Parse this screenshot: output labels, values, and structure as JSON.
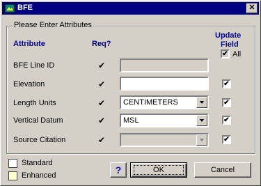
{
  "window": {
    "title": "BFE"
  },
  "group": {
    "caption": "Please Enter Attributes"
  },
  "headers": {
    "attribute": "Attribute",
    "req": "Req?",
    "update": "Update\nField",
    "update_line1": "Update",
    "update_line2": "Field",
    "all": "All"
  },
  "rows": [
    {
      "label": "BFE Line ID",
      "req": "✔",
      "value": "",
      "type": "text",
      "enabled": false,
      "update": false
    },
    {
      "label": "Elevation",
      "req": "✔",
      "value": "",
      "type": "text",
      "enabled": true,
      "update": true
    },
    {
      "label": "Length Units",
      "req": "✔",
      "value": "CENTIMETERS",
      "type": "combo",
      "enabled": true,
      "update": true
    },
    {
      "label": "Vertical Datum",
      "req": "✔",
      "value": "MSL",
      "type": "combo",
      "enabled": true,
      "update": true
    },
    {
      "label": "Source Citation",
      "req": "✔",
      "value": "",
      "type": "combo",
      "enabled": false,
      "update": true
    }
  ],
  "legend": [
    {
      "label": "Standard",
      "color": "#ffffff"
    },
    {
      "label": "Enhanced",
      "color": "#ffffcc"
    }
  ],
  "buttons": {
    "help": "?",
    "ok": "OK",
    "cancel": "Cancel"
  },
  "check_glyph": "✔"
}
